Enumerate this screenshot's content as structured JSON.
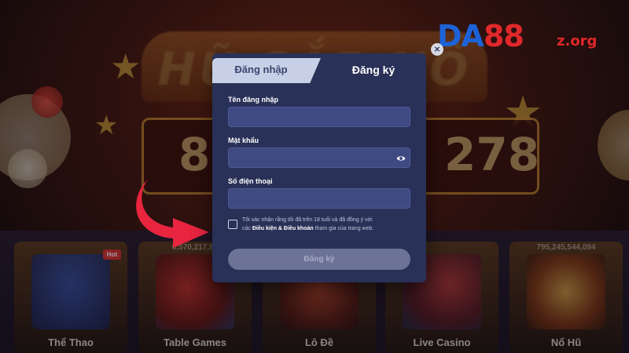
{
  "background": {
    "banner_text": "HŨ SẮP NỔ",
    "jackpot_left": "81",
    "jackpot_right": "278",
    "categories": [
      {
        "label": "Thể Thao",
        "count": "",
        "badge": "Hot"
      },
      {
        "label": "Table Games",
        "count": "6,570,217,98",
        "badge": ""
      },
      {
        "label": "Lô Đề",
        "count": "",
        "badge": ""
      },
      {
        "label": "Live Casino",
        "count": "",
        "badge": ""
      },
      {
        "label": "Nổ Hũ",
        "count": "795,245,544,094",
        "badge": ""
      }
    ],
    "colors": {
      "brand_blue": "#1d63d8",
      "brand_red": "#e0282b"
    }
  },
  "logo": {
    "main_left": "DA",
    "main_right": "88",
    "sub": "z.org"
  },
  "modal": {
    "tabs": {
      "login": "Đăng nhập",
      "register": "Đăng ký"
    },
    "close_icon": "×",
    "fields": {
      "username_label": "Tên đăng nhập",
      "username_value": "",
      "password_label": "Mật khẩu",
      "password_value": "",
      "phone_label": "Số điện thoại",
      "phone_value": ""
    },
    "consent": {
      "line1": "Tôi xác nhận rằng tôi đã trên 18 tuổi và đã đồng ý với",
      "prefix": "các",
      "terms_link": "Điều kiện & Điều khoản",
      "suffix": "tham gia của trang web."
    },
    "submit_label": "Đăng ký",
    "colors": {
      "panel": "#2a3158",
      "input": "#3f4a82",
      "tab_inactive": "#c7d0e6"
    }
  }
}
